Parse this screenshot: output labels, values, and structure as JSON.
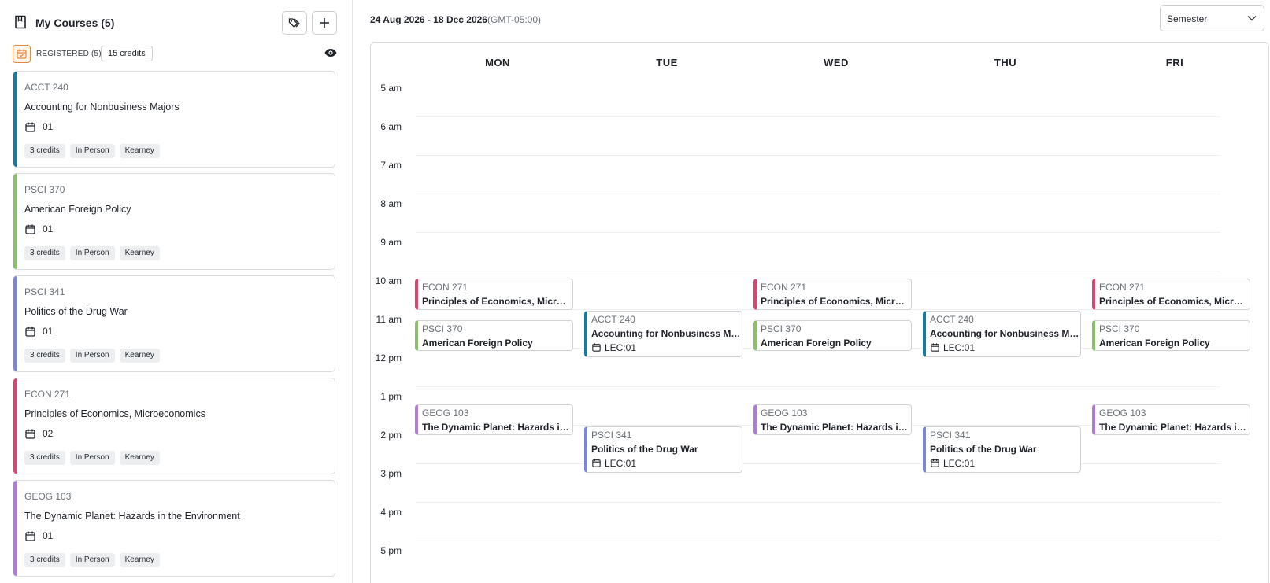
{
  "sidebar": {
    "title": "My Courses (5)",
    "registered_label": "REGISTERED (5)",
    "credits_total": "15 credits",
    "courses": [
      {
        "code": "ACCT 240",
        "name": "Accounting for Nonbusiness Majors",
        "section": "01",
        "credits": "3 credits",
        "mode": "In Person",
        "campus": "Kearney",
        "color": "#1a7a9e"
      },
      {
        "code": "PSCI 370",
        "name": "American Foreign Policy",
        "section": "01",
        "credits": "3 credits",
        "mode": "In Person",
        "campus": "Kearney",
        "color": "#8bc06b"
      },
      {
        "code": "PSCI 341",
        "name": "Politics of the Drug War",
        "section": "01",
        "credits": "3 credits",
        "mode": "In Person",
        "campus": "Kearney",
        "color": "#7b87d6"
      },
      {
        "code": "ECON 271",
        "name": "Principles of Economics, Microeconomics",
        "section": "02",
        "credits": "3 credits",
        "mode": "In Person",
        "campus": "Kearney",
        "color": "#e0426e"
      },
      {
        "code": "GEOG 103",
        "name": "The Dynamic Planet: Hazards in the Environment",
        "section": "01",
        "credits": "3 credits",
        "mode": "In Person",
        "campus": "Kearney",
        "color": "#b07ad8"
      }
    ]
  },
  "header": {
    "date_range": "24 Aug 2026 - 18 Dec 2026",
    "timezone": "(GMT-05:00)",
    "view_select": "Semester"
  },
  "calendar": {
    "days": [
      "MON",
      "TUE",
      "WED",
      "THU",
      "FRI"
    ],
    "hours": [
      "5 am",
      "6 am",
      "7 am",
      "8 am",
      "9 am",
      "10 am",
      "11 am",
      "12 pm",
      "1 pm",
      "2 pm",
      "3 pm",
      "4 pm",
      "5 pm"
    ],
    "events": [
      {
        "day": 0,
        "code": "ECON 271",
        "name": "Principles of Economics, Microeconomics",
        "section": "",
        "color": "#e0426e",
        "start": 10.17,
        "end": 10.97
      },
      {
        "day": 0,
        "code": "PSCI 370",
        "name": "American Foreign Policy",
        "section": "",
        "color": "#8bc06b",
        "start": 11.25,
        "end": 12.05
      },
      {
        "day": 0,
        "code": "GEOG 103",
        "name": "The Dynamic Planet: Hazards in the Environment",
        "section": "",
        "color": "#b07ad8",
        "start": 13.42,
        "end": 14.22
      },
      {
        "day": 1,
        "code": "ACCT 240",
        "name": "Accounting for Nonbusiness Majors",
        "section": "LEC:01",
        "color": "#1a7a9e",
        "start": 11.0,
        "end": 12.2
      },
      {
        "day": 1,
        "code": "PSCI 341",
        "name": "Politics of the Drug War",
        "section": "LEC:01",
        "color": "#7b87d6",
        "start": 14.0,
        "end": 15.2
      },
      {
        "day": 2,
        "code": "ECON 271",
        "name": "Principles of Economics, Microeconomics",
        "section": "",
        "color": "#e0426e",
        "start": 10.17,
        "end": 10.97
      },
      {
        "day": 2,
        "code": "PSCI 370",
        "name": "American Foreign Policy",
        "section": "",
        "color": "#8bc06b",
        "start": 11.25,
        "end": 12.05
      },
      {
        "day": 2,
        "code": "GEOG 103",
        "name": "The Dynamic Planet: Hazards in the Environment",
        "section": "",
        "color": "#b07ad8",
        "start": 13.42,
        "end": 14.22
      },
      {
        "day": 3,
        "code": "ACCT 240",
        "name": "Accounting for Nonbusiness Majors",
        "section": "LEC:01",
        "color": "#1a7a9e",
        "start": 11.0,
        "end": 12.2
      },
      {
        "day": 3,
        "code": "PSCI 341",
        "name": "Politics of the Drug War",
        "section": "LEC:01",
        "color": "#7b87d6",
        "start": 14.0,
        "end": 15.2
      },
      {
        "day": 4,
        "code": "ECON 271",
        "name": "Principles of Economics, Microeconomics",
        "section": "",
        "color": "#e0426e",
        "start": 10.17,
        "end": 10.97
      },
      {
        "day": 4,
        "code": "PSCI 370",
        "name": "American Foreign Policy",
        "section": "",
        "color": "#8bc06b",
        "start": 11.25,
        "end": 12.05
      },
      {
        "day": 4,
        "code": "GEOG 103",
        "name": "The Dynamic Planet: Hazards in the Environment",
        "section": "",
        "color": "#b07ad8",
        "start": 13.42,
        "end": 14.22
      }
    ]
  }
}
